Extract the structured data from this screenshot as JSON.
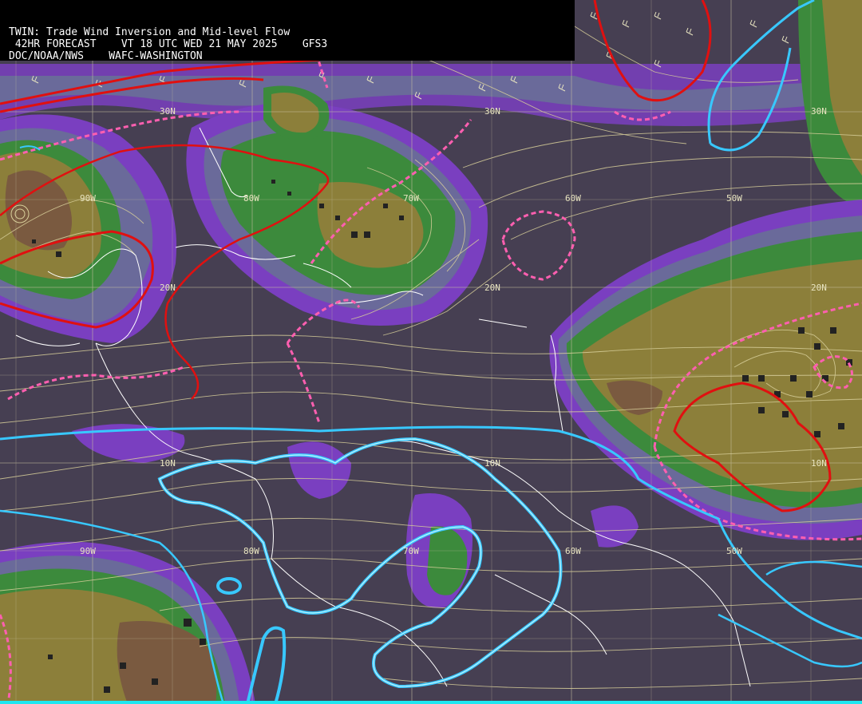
{
  "header": {
    "line1": "TWIN: Trade Wind Inversion and Mid-level Flow",
    "line2": " 42HR FORECAST    VT 18 UTC WED 21 MAY 2025    GFS3",
    "line3": "DOC/NOAA/NWS    WAFC-WASHINGTON"
  },
  "grid_labels": {
    "lat_30n": "30N",
    "lat_20n": "20N",
    "lat_10n": "10N",
    "lon_90w": "90W",
    "lon_80w": "80W",
    "lon_70w": "70W",
    "lon_60w": "60W",
    "lon_50w": "50W"
  },
  "colors": {
    "background": "#463f52",
    "purple": "#7a3fc0",
    "blue_gray": "#6a6a9a",
    "green": "#3c8a3c",
    "olive": "#8c7f3a",
    "brown": "#7a5a40",
    "red_contour": "#e01010",
    "pink_contour": "#ff5fb0",
    "cyan_contour": "#38c8ff",
    "streamline": "#d8cf9a"
  }
}
